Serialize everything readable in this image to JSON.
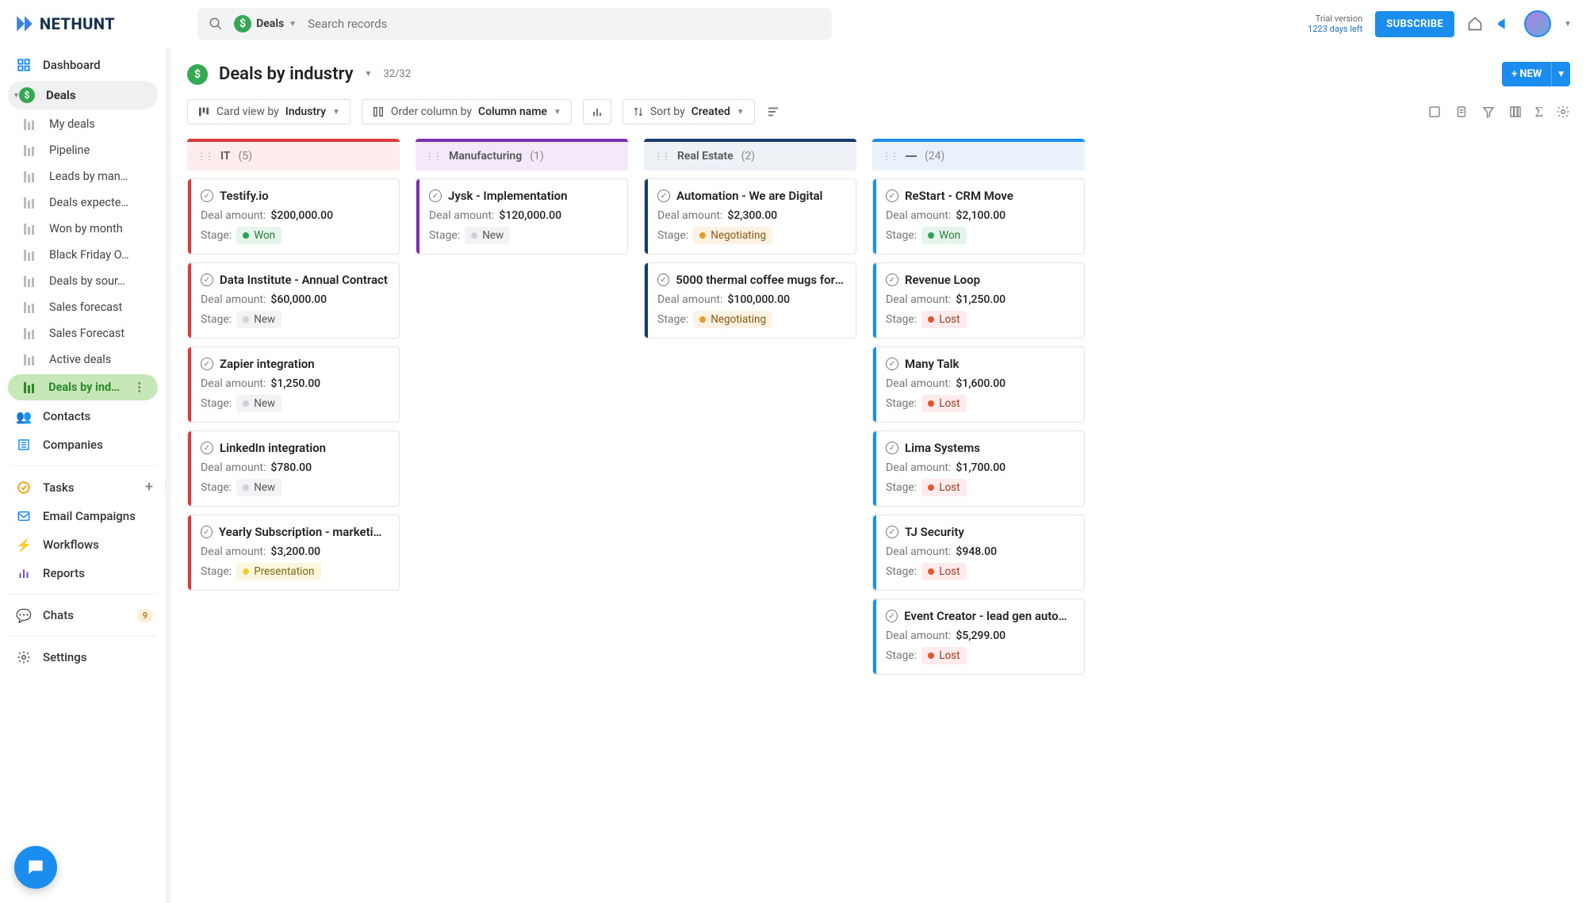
{
  "brand": "NETHUNT",
  "search": {
    "scope": "Deals",
    "placeholder": "Search records"
  },
  "trial": {
    "line1": "Trial version",
    "line2": "1223 days left"
  },
  "subscribe": "SUBSCRIBE",
  "sidebar": {
    "dashboard": "Dashboard",
    "deals_folder": "Deals",
    "views": [
      "My deals",
      "Pipeline",
      "Leads by man…",
      "Deals expecte…",
      "Won by month",
      "Black Friday O…",
      "Deals by sour…",
      "Sales forecast",
      "Sales Forecast",
      "Active deals",
      "Deals by indu…"
    ],
    "contacts": "Contacts",
    "companies": "Companies",
    "tasks": "Tasks",
    "campaigns": "Email Campaigns",
    "workflows": "Workflows",
    "reports": "Reports",
    "chats": "Chats",
    "chats_count": "9",
    "settings": "Settings"
  },
  "page": {
    "title": "Deals by industry",
    "count": "32/32",
    "new_btn": "+ NEW"
  },
  "toolbar": {
    "card_view_prefix": "Card view by",
    "card_view_value": "Industry",
    "order_prefix": "Order column by",
    "order_value": "Column name",
    "sort_prefix": "Sort by",
    "sort_value": "Created"
  },
  "labels": {
    "deal_amount": "Deal amount:",
    "stage": "Stage:"
  },
  "stages": {
    "won": "Won",
    "new": "New",
    "negotiating": "Negotiating",
    "presentation": "Presentation",
    "lost": "Lost"
  },
  "columns": [
    {
      "key": "it",
      "name": "IT",
      "count": "(5)",
      "cards": [
        {
          "title": "Testify.io",
          "amount": "$200,000.00",
          "stage": "won"
        },
        {
          "title": "Data Institute - Annual Contract",
          "amount": "$60,000.00",
          "stage": "new"
        },
        {
          "title": "Zapier integration",
          "amount": "$1,250.00",
          "stage": "new"
        },
        {
          "title": "LinkedIn integration",
          "amount": "$780.00",
          "stage": "new"
        },
        {
          "title": "Yearly Subscription - marketing t…",
          "amount": "$3,200.00",
          "stage": "presentation"
        }
      ]
    },
    {
      "key": "mfg",
      "name": "Manufacturing",
      "count": "(1)",
      "cards": [
        {
          "title": "Jysk - Implementation",
          "amount": "$120,000.00",
          "stage": "new"
        }
      ]
    },
    {
      "key": "re",
      "name": "Real Estate",
      "count": "(2)",
      "cards": [
        {
          "title": "Automation - We are Digital",
          "amount": "$2,300.00",
          "stage": "negotiating"
        },
        {
          "title": "5000 thermal coffee mugs for N…",
          "amount": "$100,000.00",
          "stage": "negotiating"
        }
      ]
    },
    {
      "key": "none",
      "name": "—",
      "count": "(24)",
      "cards": [
        {
          "title": "ReStart - CRM Move",
          "amount": "$2,100.00",
          "stage": "won"
        },
        {
          "title": "Revenue Loop",
          "amount": "$1,250.00",
          "stage": "lost"
        },
        {
          "title": "Many Talk",
          "amount": "$1,600.00",
          "stage": "lost"
        },
        {
          "title": "Lima Systems",
          "amount": "$1,700.00",
          "stage": "lost"
        },
        {
          "title": "TJ Security",
          "amount": "$948.00",
          "stage": "lost"
        },
        {
          "title": "Event Creator - lead gen automa…",
          "amount": "$5,299.00",
          "stage": "lost"
        }
      ]
    }
  ]
}
